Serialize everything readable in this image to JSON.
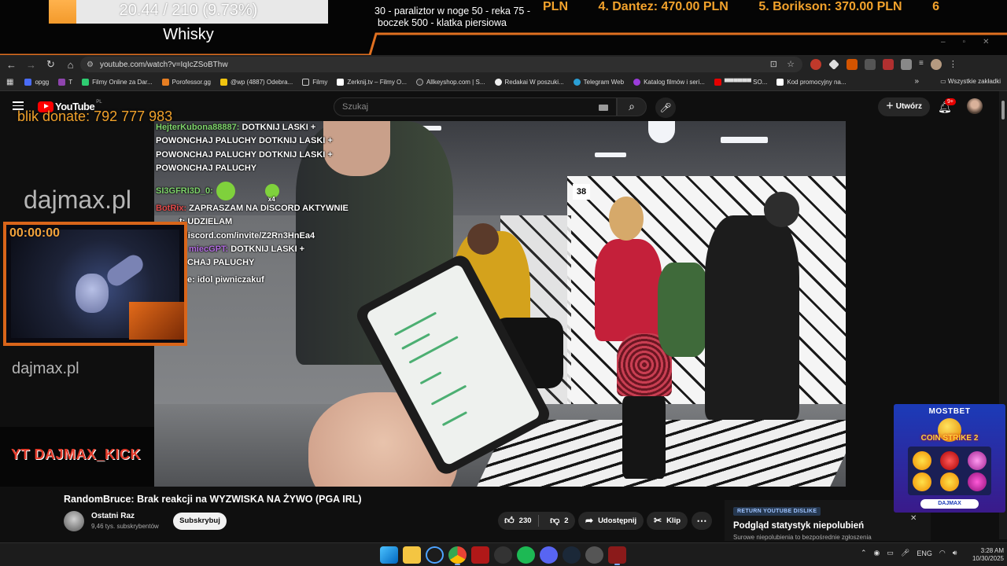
{
  "stream_overlay": {
    "goal_text": "20.44 / 210 (9.73%)",
    "goal_progress": 0.0973,
    "goal_name": "Whisky",
    "rules_line1": "30 - paraliztor w noge 50 - reka 75 -",
    "rules_line2": "boczek 500 - klatka piersiowa",
    "ranking": [
      "PLN",
      "4. Dantez: 470.00 PLN",
      "5. Borikson: 370.00 PLN",
      "6"
    ],
    "blik": "blik donate: 792 777 983",
    "site_big": "dajmax.pl",
    "site_small": "dajmax.pl",
    "timer": "00:00:00",
    "channel_tag": "YT DAJMAX_KICK",
    "accent_color": "#f39a2b"
  },
  "chat": [
    {
      "user": "HejterKubona88887:",
      "text": "DOTKNIJ LASKI + POWONCHAJ PALUCHY DOTKNIJ LASKI + POWONCHAJ PALUCHY",
      "lines": [
        "DOTKNIJ LASKI +",
        "POWONCHAJ PALUCHY DOTKNIJ LASKI +",
        "POWONCHAJ PALUCHY"
      ]
    },
    {
      "user": "SI3GFRI3D_0:",
      "emote_count": "x4"
    },
    {
      "user": "BotRix:",
      "text": "ZAPRASZAM NA DISCORD AKTYWNIE",
      "lines": [
        "t: UDZIELAM",
        "discord.com/invite/Z2Rn3HnEa4"
      ]
    },
    {
      "user": "miecGPT:",
      "text": "DOTKNIJ LASKI +",
      "lines": [
        "CHAJ PALUCHY"
      ]
    },
    {
      "user": "e:",
      "text": "idol piwniczakuf"
    }
  ],
  "browser": {
    "url": "youtube.com/watch?v=IqIcZSoBThw",
    "bookmarks": [
      "opgg",
      "T",
      "Filmy Online za Dar...",
      "Porofessor.gg",
      "@wp (4887) Odebra...",
      "Filmy",
      "Zerknij.tv – Filmy O...",
      "Allkeyshop.com | S...",
      "Redakai W poszuki...",
      "Telegram Web",
      "Katalog filmów i seri...",
      "▀▀▀▀▀▀ SO...",
      "Kod promocyjny na..."
    ],
    "bookmarks_all": "Wszystkie zakładki"
  },
  "youtube": {
    "logo": "YouTube",
    "country": "PL",
    "search_placeholder": "Szukaj",
    "create_label": "Utwórz",
    "notif_count": "9+",
    "video_title": "RandomBruce: Brak reakcji na WYZWISKA NA ŻYWO (PGA IRL)",
    "channel_name": "Ostatni Raz",
    "subscribers": "9,46 tys. subskrybentów",
    "subscribe_label": "Subskrybuj",
    "likes": "230",
    "dislikes": "2",
    "share_label": "Udostępnij",
    "clip_label": "Klip",
    "booth_number": "38"
  },
  "ryd": {
    "badge": "RETURN YOUTUBE DISLIKE",
    "title": "Podgląd statystyk niepolubień",
    "subtitle": "Surowe niepolubienia to bezpośrednie zgłoszenia"
  },
  "ad": {
    "brand": "MOSTBET",
    "game": "COIN STRIKE 2",
    "cta": "DAJMAX"
  },
  "taskbar": {
    "lang": "ENG",
    "time": "3:28 AM",
    "date": "10/30/2025"
  }
}
